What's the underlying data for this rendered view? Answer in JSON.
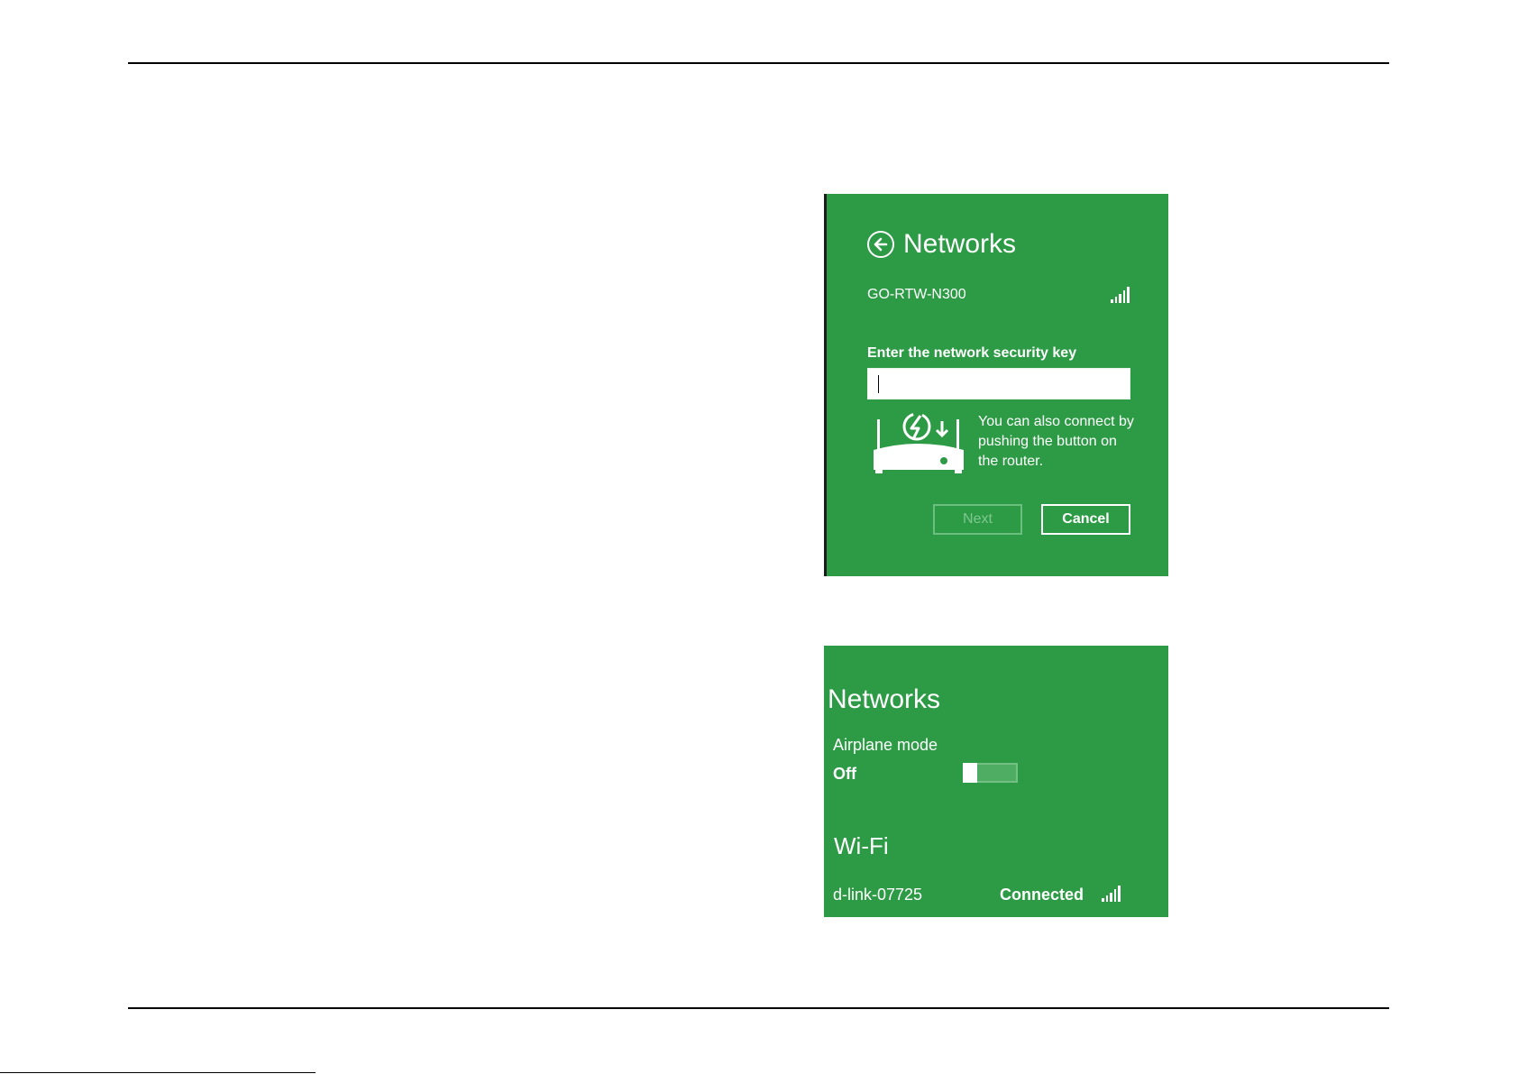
{
  "security_prompt": {
    "title": "Networks",
    "back_icon": "arrow-left-circle-icon",
    "network_name": "GO-RTW-N300",
    "signal_icon": "wifi-signal-bars-icon",
    "key_label": "Enter the network security key",
    "key_value": "",
    "wps_icon": "router-wps-icon",
    "wps_text": "You can also connect by pushing the button on the router.",
    "next_label": "Next",
    "cancel_label": "Cancel",
    "colors": {
      "background": "#2d9b45",
      "text": "#ffffff",
      "disabled": "#7ec88f"
    }
  },
  "network_list": {
    "title": "Networks",
    "airplane_mode_label": "Airplane mode",
    "airplane_mode_state": "Off",
    "wifi_heading": "Wi-Fi",
    "networks": [
      {
        "name": "d-link-07725",
        "status": "Connected",
        "signal_icon": "wifi-signal-bars-icon"
      }
    ],
    "colors": {
      "background": "#2d9b45",
      "text": "#ffffff"
    }
  }
}
